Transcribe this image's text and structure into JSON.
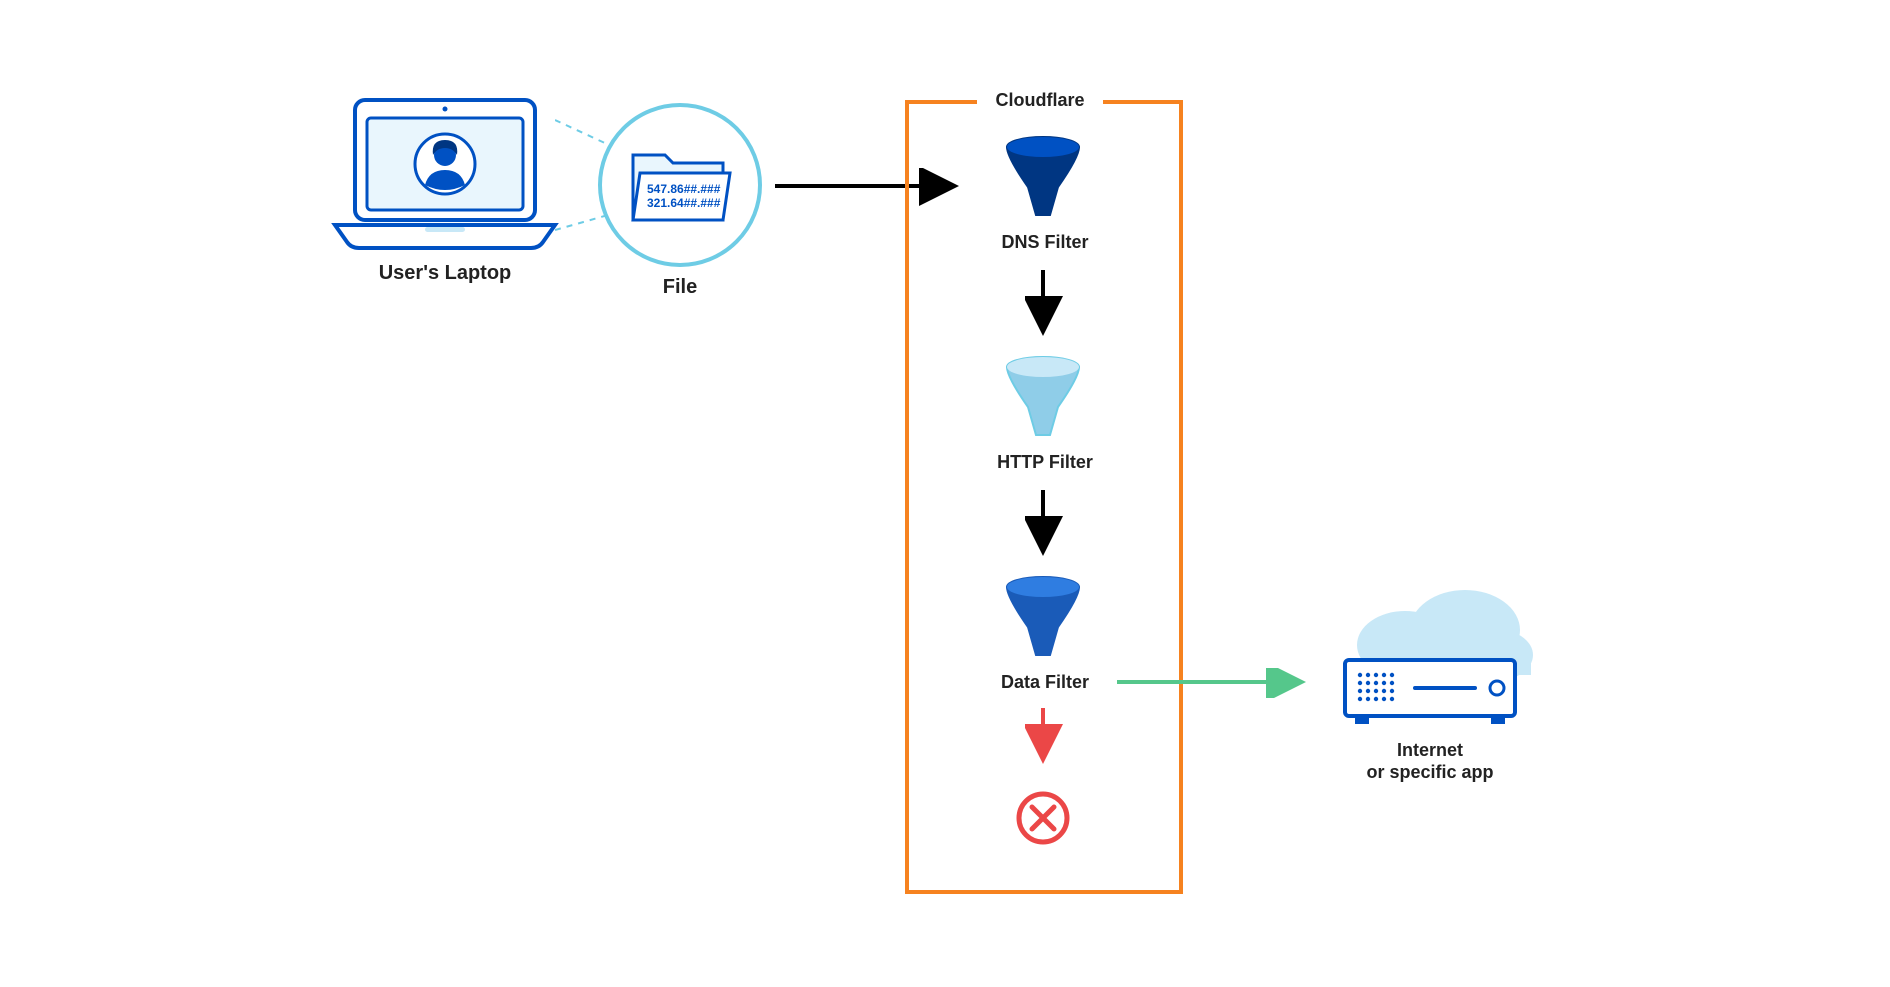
{
  "labels": {
    "laptop": "User's Laptop",
    "file": "File",
    "cloudflare": "Cloudflare",
    "dns": "DNS Filter",
    "http": "HTTP Filter",
    "data": "Data Filter",
    "internet1": "Internet",
    "internet2": "or specific app"
  },
  "file_text1": "547.86##.###",
  "file_text2": "321.64##.###",
  "colors": {
    "orange": "#F6821F",
    "blue": "#0051C3",
    "lightblue": "#9FD5F0",
    "darkblue": "#003682",
    "skyblue": "#6ECCE5",
    "green": "#55C78B",
    "red": "#EB4747",
    "text": "#222222"
  }
}
